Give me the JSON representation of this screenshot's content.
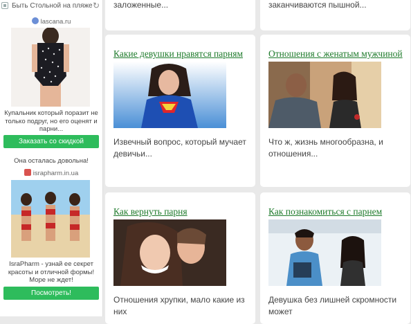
{
  "ad": {
    "title": "Быть Стольной на пляже",
    "ad1": {
      "domain": "lascana.ru",
      "text": "Купальник который поразит не только подруг, но его оценят и парни...",
      "button": "Заказать со скидкой"
    },
    "ad2": {
      "headline": "Она осталась довольна!",
      "domain": "israpharm.in.ua",
      "text": "IsraPharm - узнай ее секрет красоты и отличной формы! Море не ждет!",
      "button": "Посмотреть!"
    }
  },
  "cards": [
    {
      "snippet": "заложенные..."
    },
    {
      "snippet": "заканчиваются пышной..."
    },
    {
      "title": "Какие девушки нравятся парням",
      "desc": "Извечный вопрос, который мучает девичьи..."
    },
    {
      "title": "Отношения с женатым мужчиной",
      "desc": "Что ж, жизнь многообразна, и отношения..."
    },
    {
      "title": "Как вернуть парня",
      "desc": "Отношения хрупки, мало какие из них"
    },
    {
      "title": "Как познакомиться с парнем",
      "desc": "Девушка без лишней скромности может"
    }
  ]
}
